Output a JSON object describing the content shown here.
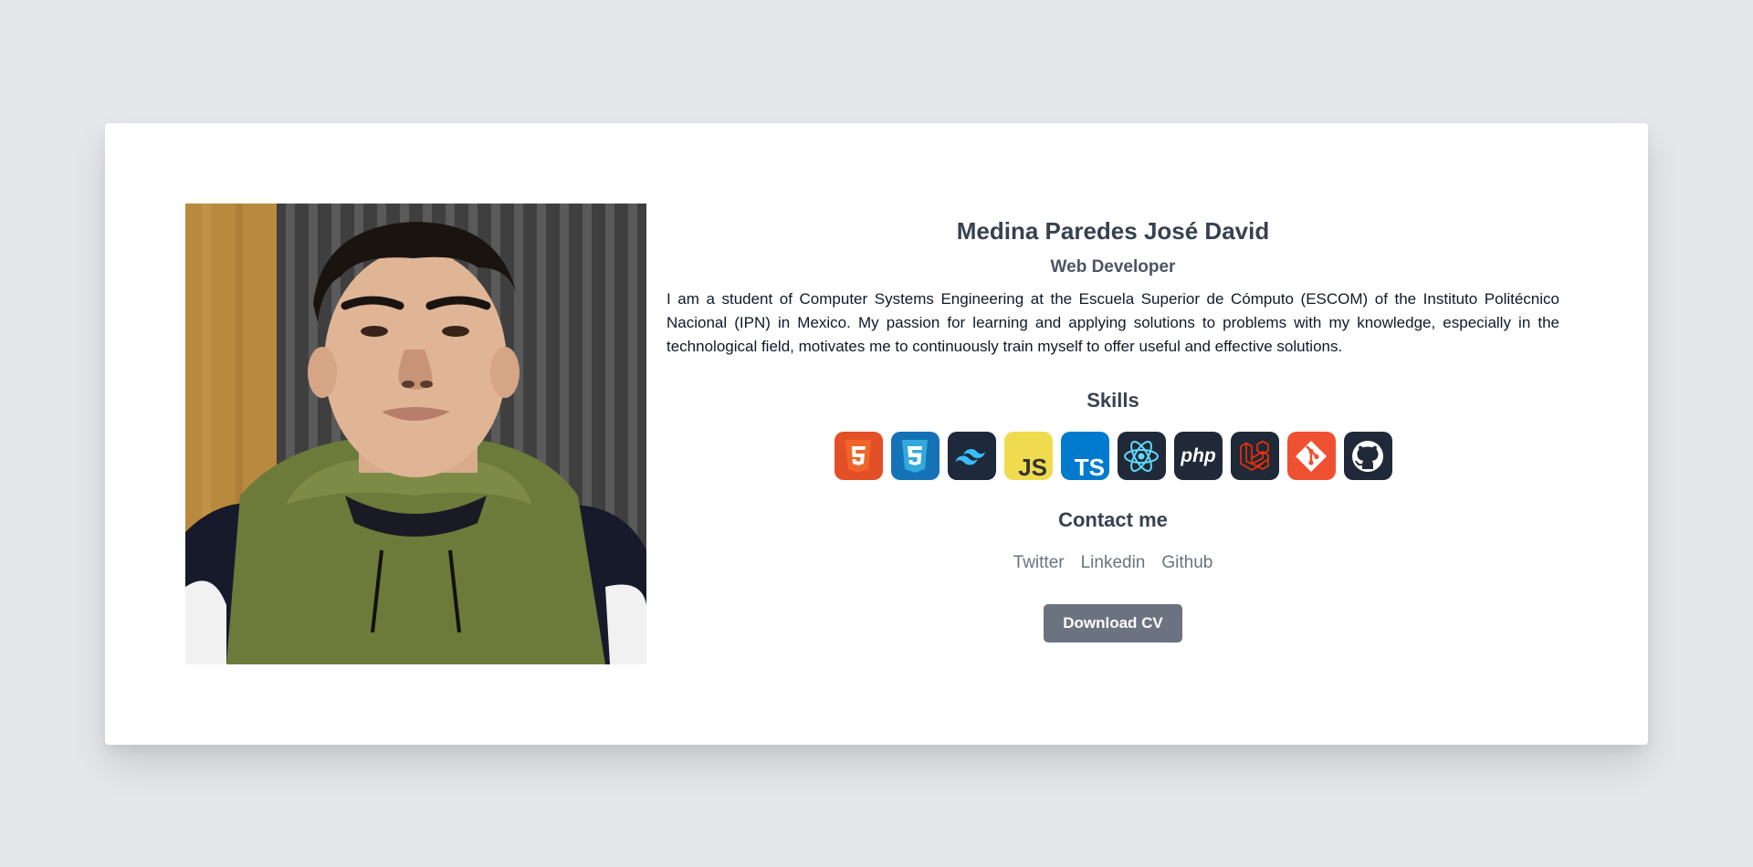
{
  "profile": {
    "name": "Medina Paredes José David",
    "role": "Web Developer",
    "bio": "I am a student of Computer Systems Engineering at the Escuela Superior de Cómputo (ESCOM) of the Instituto Politécnico Nacional (IPN) in Mexico. My passion for learning and applying solutions to problems with my knowledge, especially in the technological field, motivates me to continuously train myself to offer useful and effective solutions."
  },
  "skills": {
    "title": "Skills",
    "items": [
      {
        "icon": "html5-icon",
        "color": "#e34f26"
      },
      {
        "icon": "css3-icon",
        "color": "#1572b6"
      },
      {
        "icon": "tailwind-icon",
        "color": "#1e293b"
      },
      {
        "icon": "javascript-icon",
        "color": "#f0db4f",
        "text": "JS"
      },
      {
        "icon": "typescript-icon",
        "color": "#007acc",
        "text": "TS"
      },
      {
        "icon": "react-icon",
        "color": "#1f2937"
      },
      {
        "icon": "php-icon",
        "color": "#1f2937",
        "text": "php"
      },
      {
        "icon": "laravel-icon",
        "color": "#1f2937"
      },
      {
        "icon": "git-icon",
        "color": "#f05032"
      },
      {
        "icon": "github-icon",
        "color": "#1f2937"
      }
    ]
  },
  "contact": {
    "title": "Contact me",
    "links": [
      "Twitter",
      "Linkedin",
      "Github"
    ]
  },
  "download_button": "Download CV",
  "colors": {
    "background": "#e5e7eb",
    "card": "#ffffff",
    "button": "#6b7280",
    "heading": "#374151"
  }
}
